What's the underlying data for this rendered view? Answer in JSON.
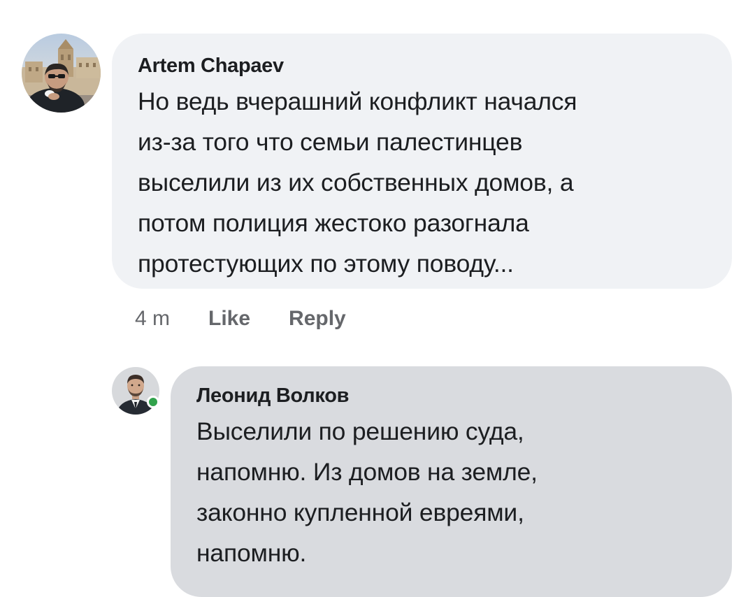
{
  "comments": [
    {
      "author": "Artem Chapaev",
      "text": "Но ведь вчерашний конфликт начался\nиз-за того что семьи палестинцев\nвыселили из их собственных домов, а\nпотом полиция жестоко разогнала\nпротестующих по этому поводу...",
      "time": "4 m",
      "like_label": "Like",
      "reply_label": "Reply"
    },
    {
      "author": "Леонид Волков",
      "text": "Выселили по решению суда,\nнапомню. Из домов на земле,\nзаконно купленной евреями,\nнапомню.",
      "online": true
    }
  ],
  "colors": {
    "bubble_primary": "#f0f2f5",
    "bubble_reply": "#d9dbdf",
    "text": "#1c1e21",
    "meta": "#65676b",
    "online": "#31a24c"
  },
  "icons": {
    "avatar_1": "user-photo-avatar",
    "avatar_2": "user-photo-avatar",
    "online_indicator": "green-dot-icon"
  }
}
